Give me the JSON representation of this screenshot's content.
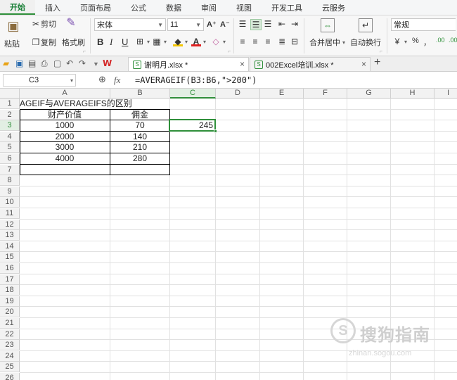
{
  "menu": {
    "tabs": [
      "开始",
      "插入",
      "页面布局",
      "公式",
      "数据",
      "审阅",
      "视图",
      "开发工具",
      "云服务"
    ],
    "active_index": 0
  },
  "ribbon": {
    "paste": "粘贴",
    "cut": "剪切",
    "copy": "复制",
    "format_painter": "格式刷",
    "font_name": "宋体",
    "font_size": "11",
    "bold": "B",
    "italic": "I",
    "underline": "U",
    "grow_font": "A⁺",
    "shrink_font": "A⁻",
    "font_color": "A",
    "merge_center": "合并居中",
    "wrap_text": "自动换行",
    "number_format": "常规",
    "percent": "%",
    "comma": "，",
    "inc_decimal": ".00",
    "dec_decimal": ".00"
  },
  "docs": {
    "brand": "W",
    "tabs": [
      {
        "name": "谢明月.xlsx *",
        "active": true
      },
      {
        "name": "002Excel培训.xlsx *",
        "active": false
      }
    ],
    "add": "+"
  },
  "formula_bar": {
    "cell_ref": "C3",
    "fx": "fx",
    "formula": "=AVERAGEIF(B3:B6,\">200\")"
  },
  "grid": {
    "columns": [
      "A",
      "B",
      "C",
      "D",
      "E",
      "F",
      "G",
      "H",
      "I"
    ],
    "selected_column": "C",
    "rows": [
      "1",
      "2",
      "3",
      "4",
      "5",
      "6",
      "7",
      "8",
      "9",
      "10",
      "11",
      "12",
      "13",
      "14",
      "15",
      "16",
      "17",
      "18",
      "19",
      "20",
      "21",
      "22",
      "23",
      "24",
      "25",
      "26"
    ],
    "selected_row": "3",
    "title": "AGEIF与AVERAGEIFS的区别",
    "headers": [
      "财产价值",
      "佣金"
    ],
    "data": [
      [
        "1000",
        "70"
      ],
      [
        "2000",
        "140"
      ],
      [
        "3000",
        "210"
      ],
      [
        "4000",
        "280"
      ]
    ],
    "result": "245"
  },
  "watermark": {
    "text": "搜狗指南",
    "sub": "zhinan.sogou.com"
  },
  "colors": {
    "accent": "#2f8f3a"
  }
}
